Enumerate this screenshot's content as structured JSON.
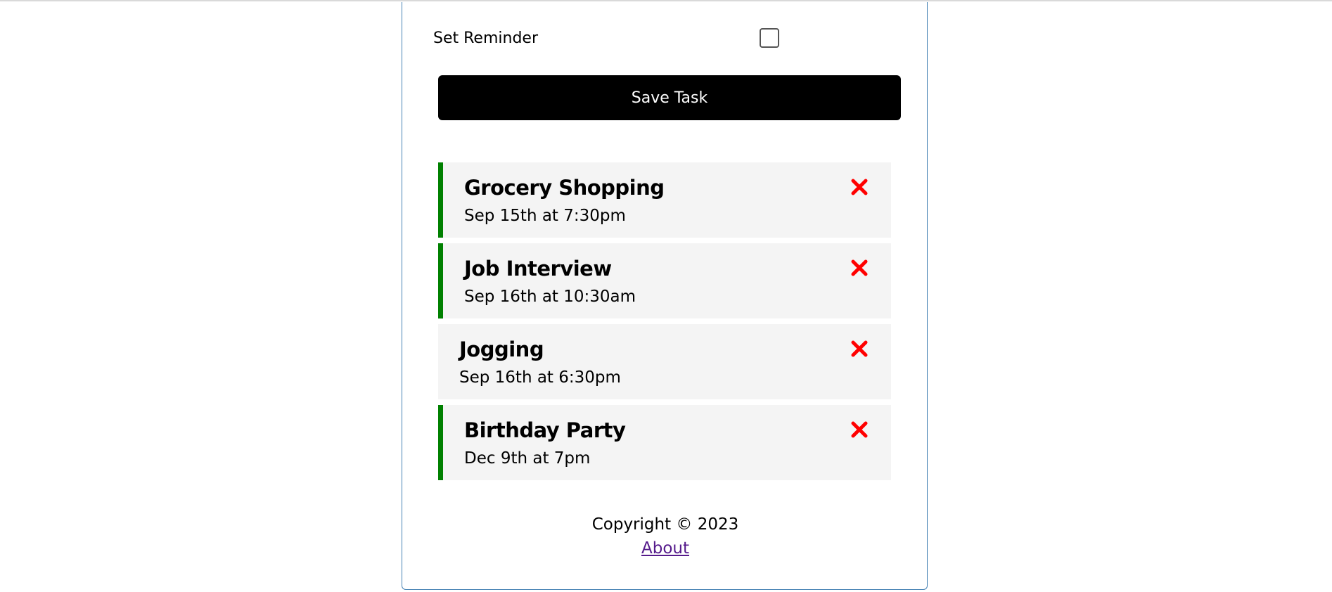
{
  "form": {
    "reminder_label": "Set Reminder",
    "reminder_checked": false,
    "save_label": "Save Task"
  },
  "tasks": [
    {
      "text": "Grocery Shopping",
      "day": "Sep 15th at 7:30pm",
      "reminder": true
    },
    {
      "text": "Job Interview",
      "day": "Sep 16th at 10:30am",
      "reminder": true
    },
    {
      "text": "Jogging",
      "day": "Sep 16th at 6:30pm",
      "reminder": false
    },
    {
      "text": "Birthday Party",
      "day": "Dec 9th at 7pm",
      "reminder": true
    }
  ],
  "footer": {
    "copyright": "Copyright © 2023",
    "about_link": "About"
  },
  "colors": {
    "reminder_border": "#008000",
    "delete_icon": "#ff0000",
    "button_bg": "#000000",
    "link": "#551a8b"
  },
  "icons": {
    "delete": "times-icon"
  }
}
